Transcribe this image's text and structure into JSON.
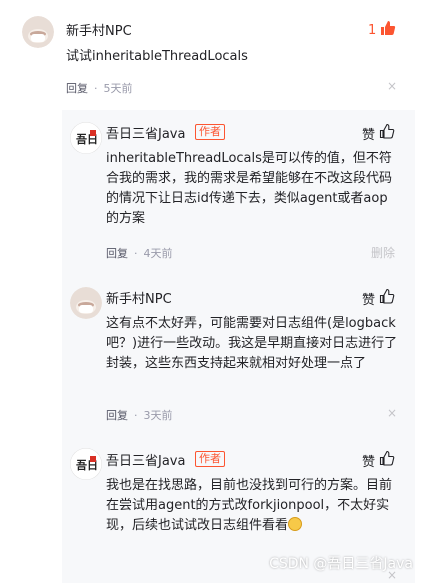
{
  "comment": {
    "user": "新手村NPC",
    "text": "试试inheritableThreadLocals",
    "reply_label": "回复",
    "time": "5天前",
    "like_count": "1",
    "close_symbol": "×"
  },
  "replies": [
    {
      "user": "吾日三省Java",
      "author_tag": "作者",
      "text": "inheritableThreadLocals是可以传的值，但不符合我的需求，我的需求是希望能够在不改这段代码的情况下让日志id传递下去，类似agent或者aop的方案",
      "reply_label": "回复",
      "time": "4天前",
      "like_label": "赞",
      "delete_label": "删除"
    },
    {
      "user": "新手村NPC",
      "text": "这有点不太好弄，可能需要对日志组件(是logback吧？)进行一些改动。我这是早期直接对日志进行了封装，这些东西支持起来就相对好处理一点了",
      "reply_label": "回复",
      "time": "3天前",
      "like_label": "赞",
      "close_symbol": "×"
    },
    {
      "user": "吾日三省Java",
      "author_tag": "作者",
      "text": "我也是在找思路，目前也没找到可行的方案。目前在尝试用agent的方式改forkjionpool，不太好实现，后续也试试改日志组件看看",
      "reply_label": "回复",
      "time": "3天前",
      "like_label": "赞",
      "close_symbol": "×"
    }
  ],
  "watermark": "CSDN @吾日三省Java",
  "colors": {
    "accent": "#fc5531",
    "reply_bg": "#f7f8fa",
    "text": "#222226",
    "muted": "#999aaa"
  }
}
